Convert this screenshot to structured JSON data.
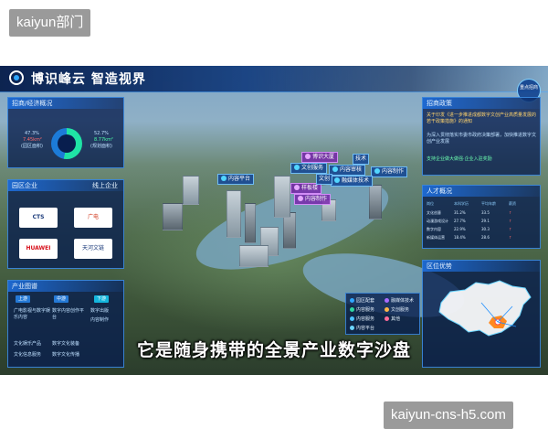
{
  "watermarks": {
    "top": "kaiyun部门",
    "bottom": "kaiyun-cns-h5.com"
  },
  "header": {
    "title": "博识峰云  智造视界"
  },
  "left": {
    "econ": {
      "title": "招商/经济概况",
      "left_pct": "47.3%",
      "left_val": "7.45km²",
      "left_note": "(园区面积)",
      "right_pct": "52.7%",
      "right_val": "8.77km²",
      "right_note": "(规划面积)"
    },
    "companies": {
      "title": "园区企业",
      "more": "线上企业",
      "logos": [
        "CTS",
        "广电",
        "HUAWEI",
        "天河文链"
      ]
    },
    "chain": {
      "title": "产业图谱",
      "stages": [
        "上游",
        "中游",
        "下游"
      ],
      "items": [
        "广电影视与数字娱乐内容",
        "数字内容创作平台",
        "数字出版",
        "内容制作",
        "文化娱乐产品",
        "数字文化装备",
        "文化信息服务",
        "数字文化传播"
      ]
    }
  },
  "right": {
    "policy": {
      "title": "招商政策",
      "badge": "重点招商",
      "line1": "关于印发《进一步推进成都数字文创产业高质量发展的若干政策措施》的通知",
      "line2": "为深入贯彻落实市委市政府决策部署，加快推进数字文创产业发展",
      "line3": "支持企业做大做强·企业入驻奖励"
    },
    "talent": {
      "title": "人才概况",
      "headers": [
        "岗位",
        "本科学历",
        "平均年龄",
        "薪资",
        "需求"
      ],
      "rows": [
        [
          "文化创意",
          "31.2%",
          "33.5",
          "↑"
        ],
        [
          "动漫游戏设计",
          "27.7%",
          "29.1",
          "↑"
        ],
        [
          "数字内容",
          "22.9%",
          "30.3",
          "↑"
        ],
        [
          "新媒体运营",
          "18.4%",
          "28.6",
          "↑"
        ]
      ]
    },
    "region": {
      "title": "区位优势"
    }
  },
  "map": {
    "labels": [
      {
        "text": "博识大厦",
        "kind": "alt"
      },
      {
        "text": "文创服务",
        "kind": "normal"
      },
      {
        "text": "内容审核",
        "kind": "normal"
      },
      {
        "text": "内容制作",
        "kind": "normal"
      },
      {
        "text": "融媒体技术",
        "kind": "normal"
      },
      {
        "text": "内容平台",
        "kind": "normal"
      },
      {
        "text": "样板楼",
        "kind": "alt"
      },
      {
        "text": "内容制作",
        "kind": "alt"
      },
      {
        "text": "文创",
        "kind": "normal"
      },
      {
        "text": "技术",
        "kind": "normal"
      }
    ],
    "legend": [
      {
        "text": "园区配套",
        "color": "#2fa6ff"
      },
      {
        "text": "融媒体技术",
        "color": "#a86bff"
      },
      {
        "text": "内容服务",
        "color": "#2fd6a0"
      },
      {
        "text": "文创服务",
        "color": "#ffb648"
      },
      {
        "text": "内容服务",
        "color": "#4cc3ff"
      },
      {
        "text": "其他",
        "color": "#ff6b9b"
      },
      {
        "text": "内容平台",
        "color": "#6cd6ff"
      }
    ],
    "subtitle": "它是随身携带的全景产业数字沙盘"
  }
}
